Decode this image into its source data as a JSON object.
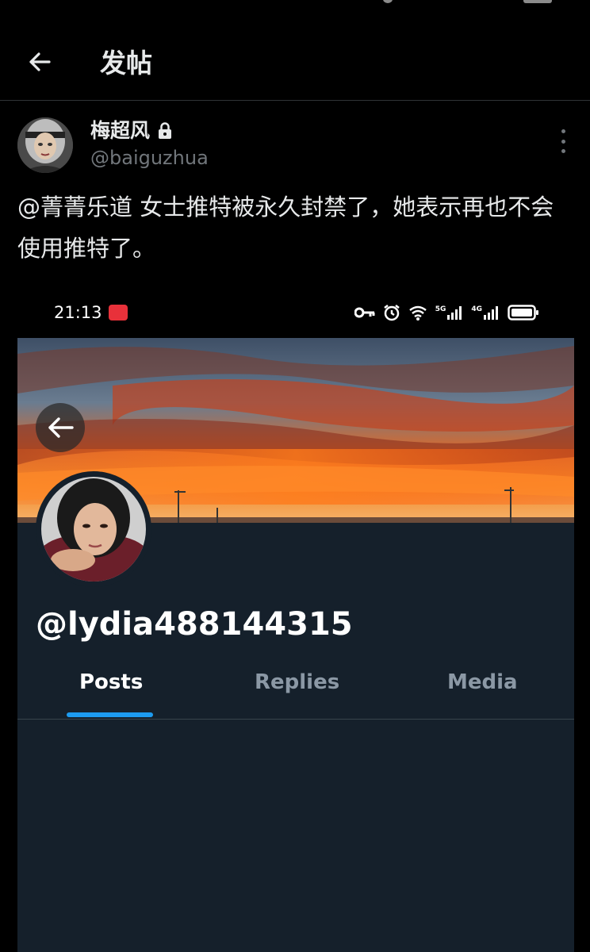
{
  "nav": {
    "title": "发帖"
  },
  "post": {
    "author_name": "梅超风",
    "author_handle": "@baiguzhua",
    "text": "@菁菁乐道 女士推特被永久封禁了，她表示再也不会使用推特了。"
  },
  "screenshot": {
    "status_time": "21:13",
    "profile_handle": "@lydia488144315",
    "tabs": [
      "Posts",
      "Replies",
      "Media"
    ],
    "active_tab": "Posts",
    "status_labels": {
      "net1": "5G",
      "net2": "4G"
    }
  },
  "colors": {
    "accent": "#1d9bf0",
    "profile_bg": "#15202b",
    "muted": "#71767b"
  }
}
